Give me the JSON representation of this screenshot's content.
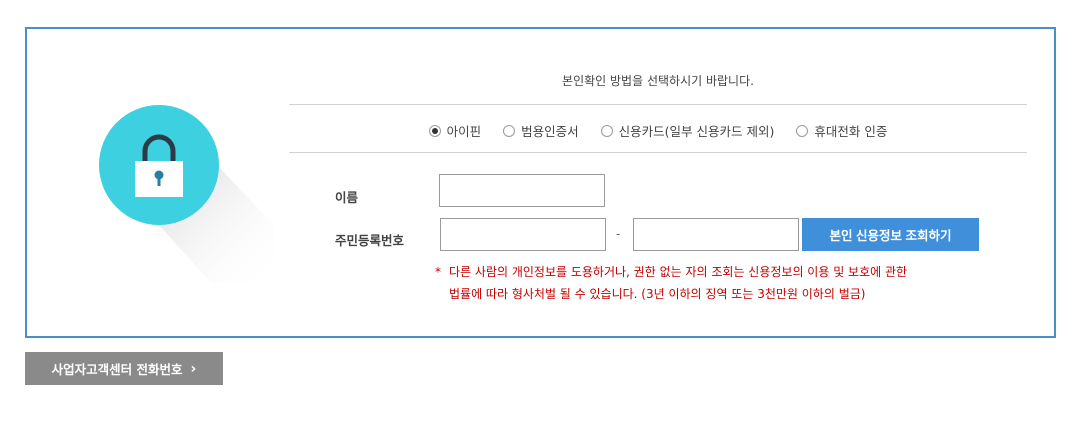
{
  "instruction": "본인확인 방법을 선택하시기 바랍니다.",
  "methods": [
    {
      "label": "아이핀",
      "selected": true
    },
    {
      "label": "범용인증서",
      "selected": false
    },
    {
      "label": "신용카드(일부 신용카드 제외)",
      "selected": false
    },
    {
      "label": "휴대전화 인증",
      "selected": false
    }
  ],
  "form": {
    "name_label": "이름",
    "rrn_label": "주민등록번호",
    "rrn_separator": "-",
    "submit_label": "본인 신용정보 조회하기"
  },
  "warning": {
    "marker": "*",
    "line1": "다른 사람의 개인정보를 도용하거나, 권한 없는 자의 조회는 신용정보의 이용 및 보호에 관한",
    "line2": "법률에 따라 형사처벌 될 수 있습니다. (3년 이하의 징역 또는 3천만원 이하의 벌금)"
  },
  "footer_button": {
    "label": "사업자고객센터 전화번호",
    "icon": "chevron-right-icon"
  },
  "colors": {
    "panel_border": "#4a8fc7",
    "primary_button": "#3f8fdb",
    "warning_text": "#c40000",
    "lock_circle": "#3dd0e0",
    "footer_button": "#8a8a8a"
  }
}
